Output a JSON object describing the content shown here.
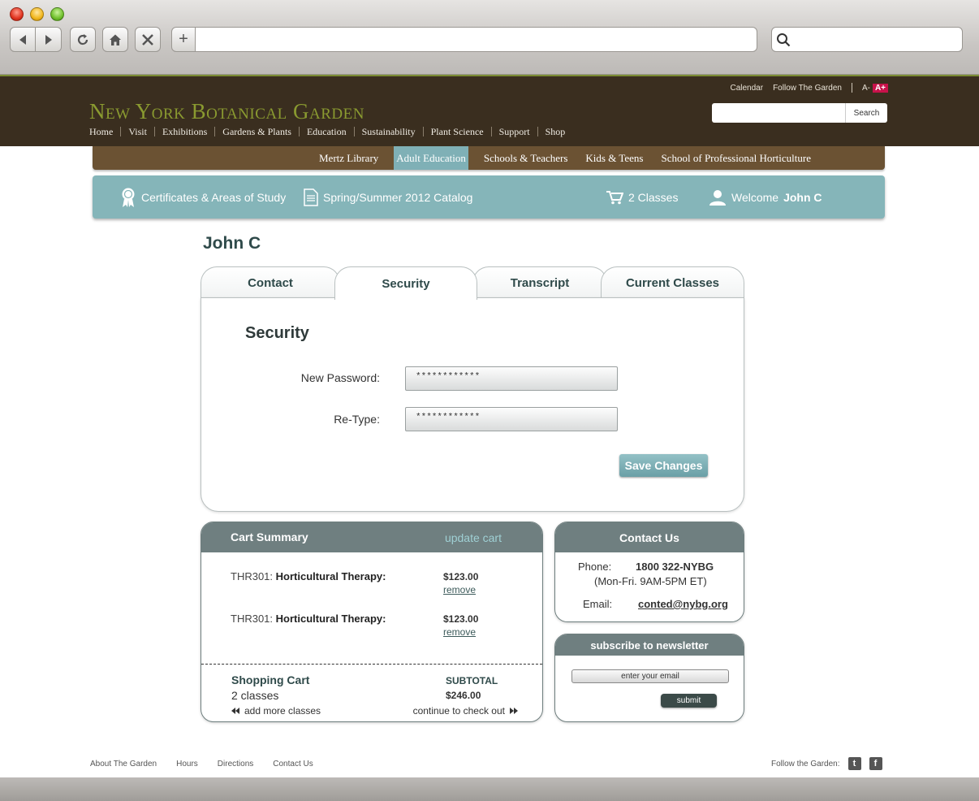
{
  "browser": {
    "new_tab_label": "+"
  },
  "header": {
    "util_links": [
      "Calendar",
      "Follow The Garden"
    ],
    "font_small": "A-",
    "font_large": "A+",
    "logo": "New York Botanical Garden",
    "search_button": "Search",
    "nav": [
      "Home",
      "Visit",
      "Exhibitions",
      "Gardens & Plants",
      "Education",
      "Sustainability",
      "Plant Science",
      "Support",
      "Shop"
    ]
  },
  "subnav": [
    "Mertz Library",
    "Adult Education",
    "Schools & Teachers",
    "Kids & Teens",
    "School of Professional Horticulture"
  ],
  "toolbar": {
    "certificates": "Certificates & Areas of Study",
    "catalog": "Spring/Summer 2012 Catalog",
    "cart_count": "2 Classes",
    "welcome": "Welcome",
    "user": "John C"
  },
  "page": {
    "title": "John C",
    "tabs": [
      "Contact",
      "Security",
      "Transcript",
      "Current Classes"
    ],
    "active_tab": "Security"
  },
  "security": {
    "title": "Security",
    "new_password_label": "New Password:",
    "new_password_value": "************",
    "retype_label": "Re-Type:",
    "retype_value": "************",
    "save_label": "Save Changes"
  },
  "cart": {
    "title": "Cart Summary",
    "update": "update cart",
    "items": [
      {
        "code": "THR301:",
        "name": "Horticultural Therapy:",
        "price": "$123.00",
        "remove": "remove"
      },
      {
        "code": "THR301:",
        "name": "Horticultural Therapy:",
        "price": "$123.00",
        "remove": "remove"
      }
    ],
    "shopping_cart": "Shopping Cart",
    "count": "2 classes",
    "subtotal_label": "SUBTOTAL",
    "subtotal": "$246.00",
    "add_more": "add more classes",
    "continue": "continue to check out"
  },
  "contact": {
    "title": "Contact Us",
    "phone_label": "Phone:",
    "phone": "1800 322-NYBG",
    "hours": "(Mon-Fri. 9AM-5PM ET)",
    "email_label": "Email:",
    "email": "conted@nybg.org"
  },
  "newsletter": {
    "title": "subscribe to newsletter",
    "placeholder": "enter your email",
    "submit": "submit"
  },
  "footer": {
    "links": [
      "About The Garden",
      "Hours",
      "Directions",
      "Contact Us"
    ],
    "follow": "Follow the Garden:",
    "twitter": "t",
    "facebook": "f"
  },
  "colors": {
    "header_bg": "#3a2e1f",
    "subnav_bg": "#6b5233",
    "accent_teal": "#85b5b9",
    "logo_green": "#8a9a30",
    "box_head": "#6f7f80"
  }
}
